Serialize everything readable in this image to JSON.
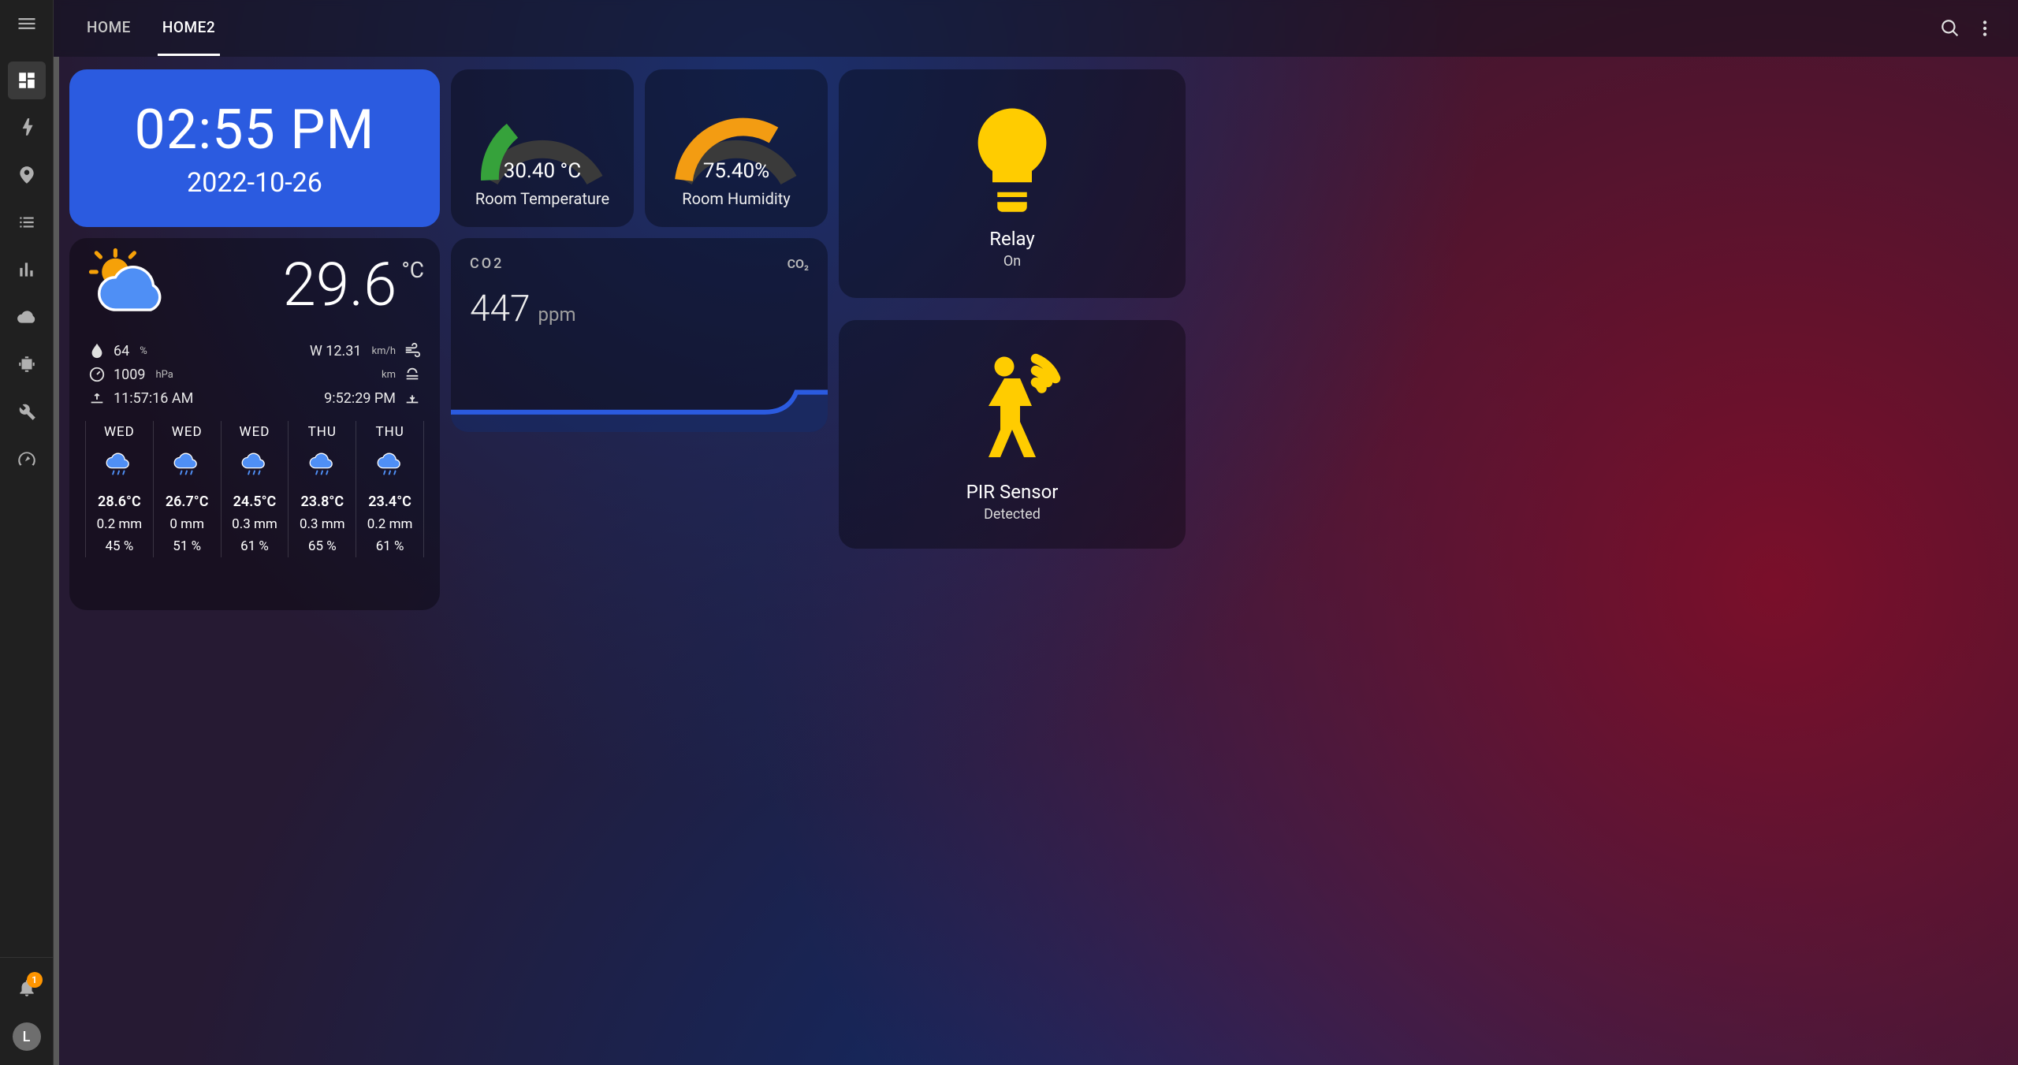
{
  "sidebar": {
    "avatar_initial": "L",
    "notification_count": "1"
  },
  "header": {
    "tabs": [
      {
        "label": "HOME",
        "active": false
      },
      {
        "label": "HOME2",
        "active": true
      }
    ]
  },
  "clock": {
    "time": "02:55 PM",
    "date": "2022-10-26"
  },
  "gauges": {
    "temperature": {
      "value": "30.40 °C",
      "label": "Room Temperature",
      "fraction": 0.3
    },
    "humidity": {
      "value": "75.40%",
      "label": "Room Humidity",
      "fraction": 0.75
    }
  },
  "relay": {
    "title": "Relay",
    "state": "On"
  },
  "pir": {
    "title": "PIR Sensor",
    "state": "Detected"
  },
  "weather": {
    "current_temp": "29.6",
    "current_unit": "°C",
    "humidity": "64",
    "humidity_unit": "%",
    "pressure": "1009",
    "pressure_unit": "hPa",
    "sunrise": "11:57:16 AM",
    "wind": "W 12.31",
    "wind_unit": "km/h",
    "visibility": "",
    "visibility_unit": "km",
    "sunset": "9:52:29 PM",
    "forecast": [
      {
        "day": "WED",
        "temp": "28.6°C",
        "precip": "0.2 mm",
        "humidity": "45 %"
      },
      {
        "day": "WED",
        "temp": "26.7°C",
        "precip": "0 mm",
        "humidity": "51 %"
      },
      {
        "day": "WED",
        "temp": "24.5°C",
        "precip": "0.3 mm",
        "humidity": "61 %"
      },
      {
        "day": "THU",
        "temp": "23.8°C",
        "precip": "0.3 mm",
        "humidity": "65 %"
      },
      {
        "day": "THU",
        "temp": "23.4°C",
        "precip": "0.2 mm",
        "humidity": "61 %"
      }
    ]
  },
  "co2": {
    "title": "CO2",
    "value": "447",
    "unit": "ppm",
    "icon_text": "CO₂"
  },
  "chart_data": {
    "type": "line",
    "title": "CO2",
    "ylabel": "ppm",
    "x_note": "time (unlabeled)",
    "series": [
      {
        "name": "CO2",
        "values": [
          445,
          445,
          445,
          445,
          445,
          445,
          445,
          445,
          445,
          445,
          445,
          445,
          447
        ]
      }
    ],
    "ylim": [
      0,
      1000
    ]
  }
}
